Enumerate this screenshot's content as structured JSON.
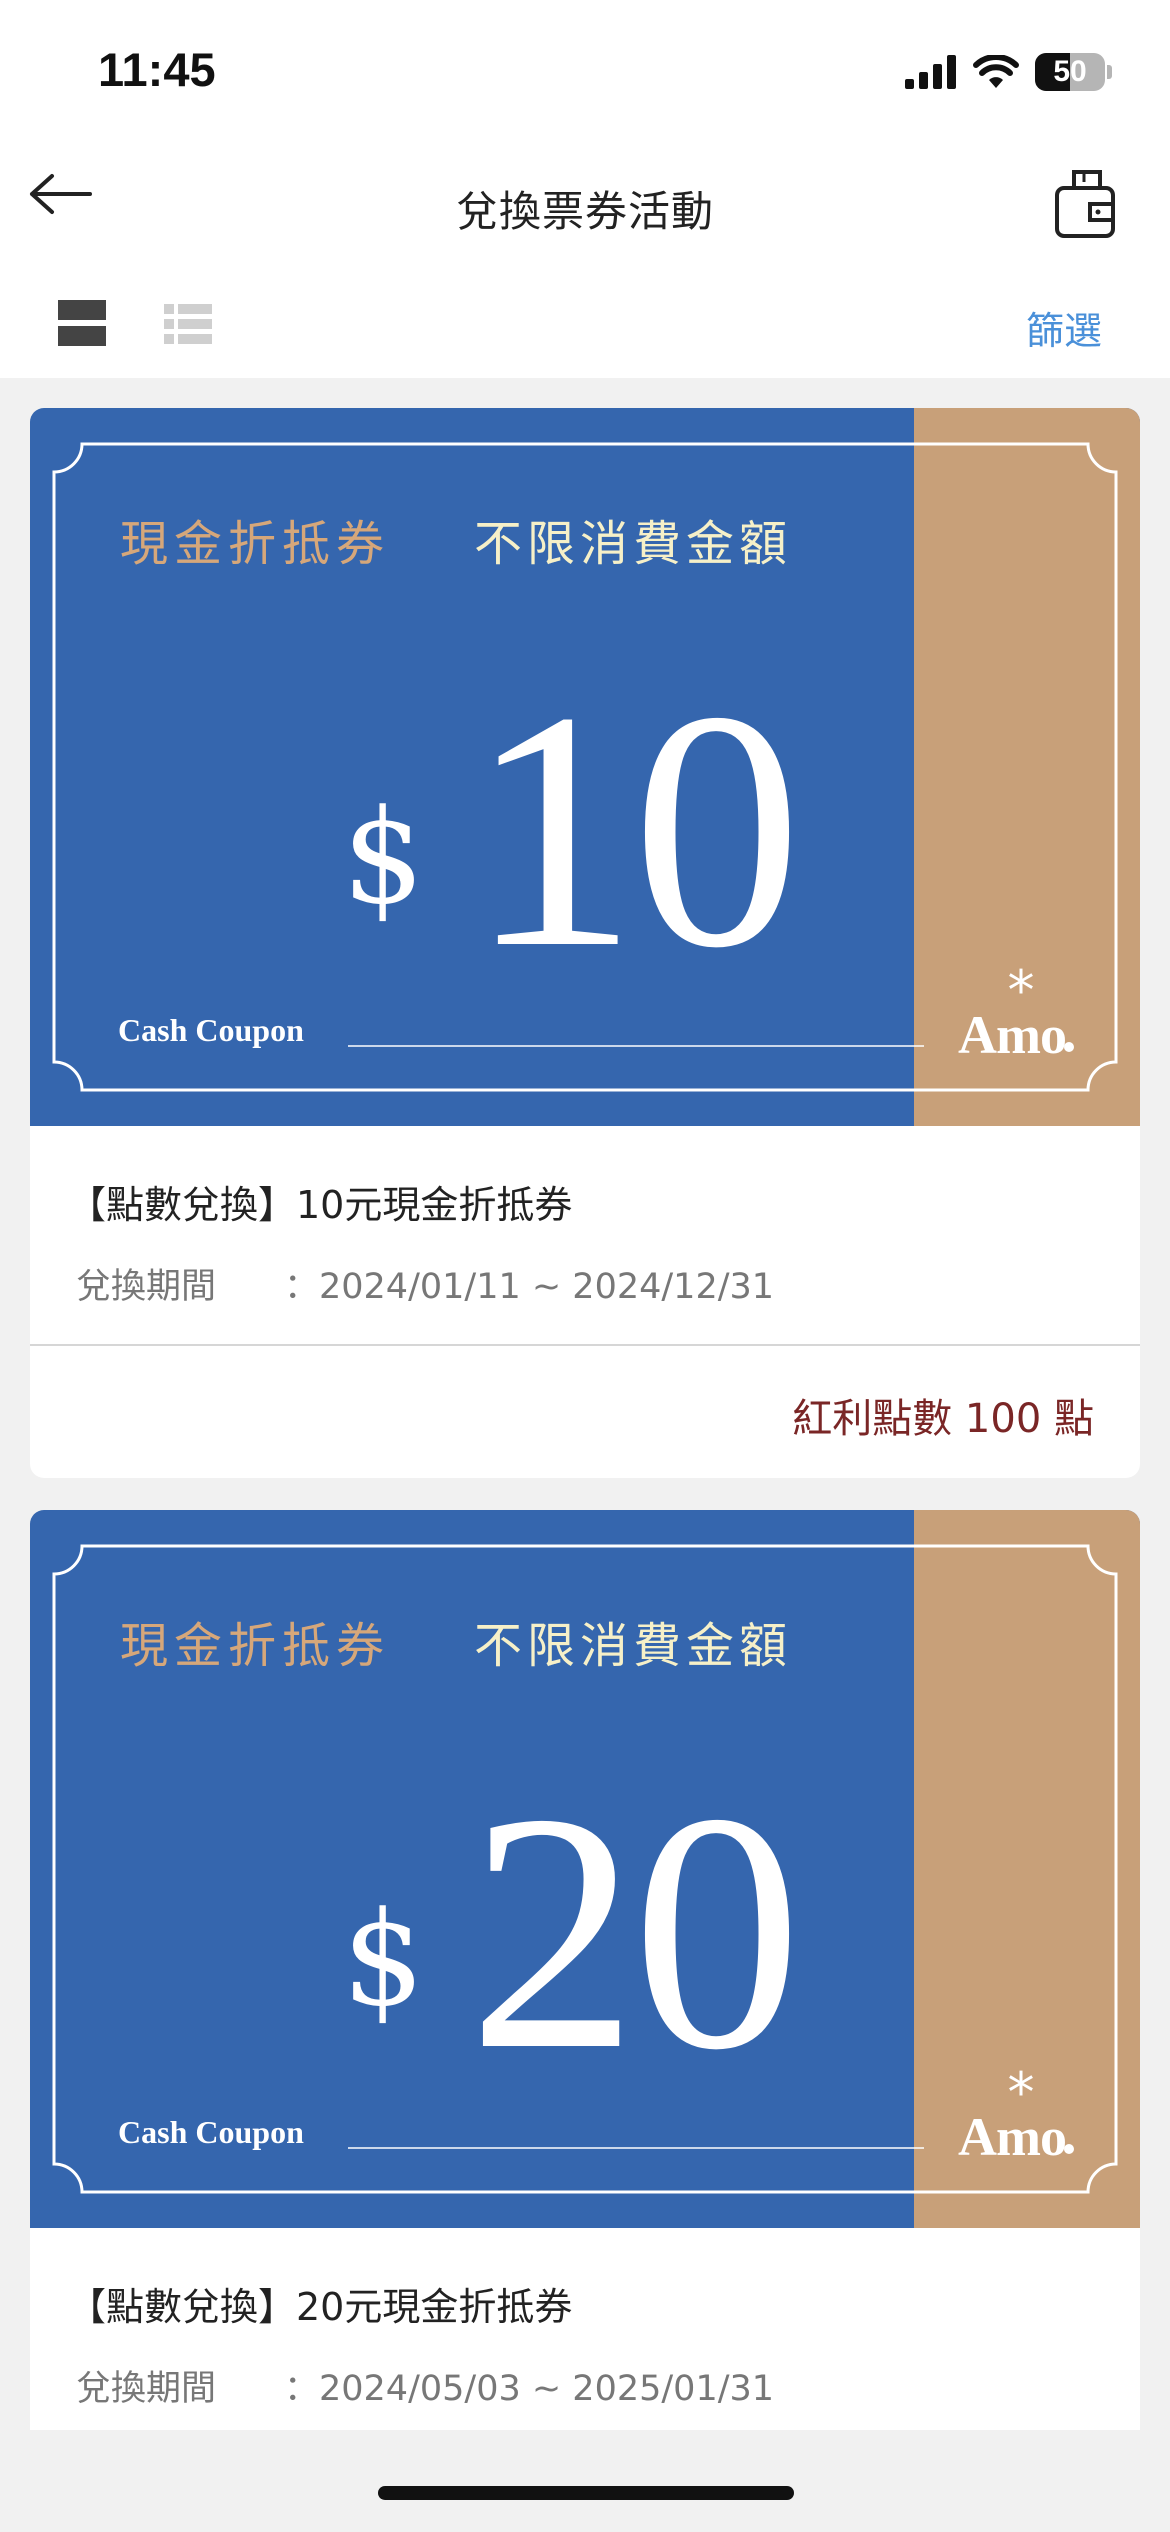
{
  "status_bar": {
    "time": "11:45",
    "battery": "50",
    "battery_level": 0.5
  },
  "nav": {
    "title": "兌換票券活動",
    "back_icon": "arrow-left-icon",
    "wallet_icon": "wallet-icon"
  },
  "toolbar": {
    "grid_view_icon": "grid-view-icon",
    "list_view_icon": "list-view-icon",
    "filter_label": "篩選"
  },
  "colors": {
    "coupon_blue": "#3566ae",
    "coupon_tan": "#c8a079",
    "filter_blue": "#4a90d9",
    "points_red": "#7a2626"
  },
  "cards": [
    {
      "coupon": {
        "type": "現金折抵券",
        "condition": "不限消費金額",
        "currency": "$",
        "amount": "10",
        "label_en": "Cash Coupon",
        "brand": "Amo",
        "brand_mark": "*"
      },
      "title": "【點數兌換】10元現金折抵券",
      "period_label": "兌換期間",
      "period_value": "：2024/01/11 ~ 2024/12/31",
      "points": "紅利點數 100 點"
    },
    {
      "coupon": {
        "type": "現金折抵券",
        "condition": "不限消費金額",
        "currency": "$",
        "amount": "20",
        "label_en": "Cash Coupon",
        "brand": "Amo",
        "brand_mark": "*"
      },
      "title": "【點數兌換】20元現金折抵券",
      "period_label": "兌換期間",
      "period_value": "：2024/05/03 ~ 2025/01/31"
    }
  ]
}
